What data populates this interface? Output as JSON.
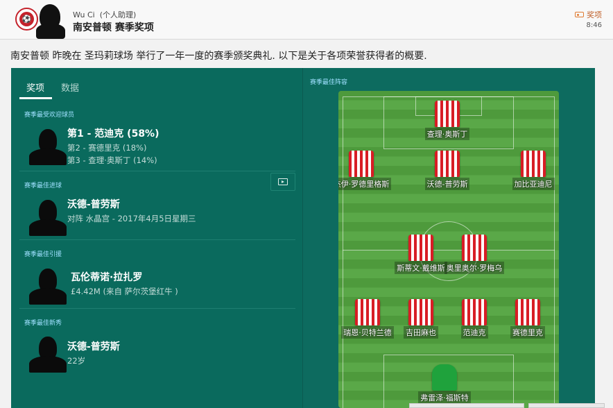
{
  "header": {
    "sender_name": "Wu Ci",
    "sender_role": "(个人助理)",
    "title": "南安普顿 赛季奖项",
    "tag_label": "奖项",
    "time": "8:46"
  },
  "intro": "南安普顿 昨晚在 圣玛莉球场 举行了一年一度的赛季颁奖典礼. 以下是关于各项荣誉获得者的概要.",
  "tabs": [
    {
      "label": "奖项",
      "active": true
    },
    {
      "label": "数据",
      "active": false
    }
  ],
  "awards": [
    {
      "title": "赛季最受欢迎球员",
      "winner": "第1 - 范迪克 (58%)",
      "line2": "第2 - 赛德里克 (18%)",
      "line3": "第3 - 查理·奥斯丁 (14%)"
    },
    {
      "title": "赛季最佳进球",
      "winner": "沃德-普劳斯",
      "line2": "对阵 水晶宫 - 2017年4月5日星期三"
    },
    {
      "title": "赛季最佳引援",
      "winner": "瓦伦蒂诺·拉扎罗",
      "line2": "£4.42M (来自 萨尔茨堡红牛 )"
    },
    {
      "title": "赛季最佳新秀",
      "winner": "沃德-普劳斯",
      "line2": "22岁"
    }
  ],
  "team_of_season": {
    "title": "赛季最佳阵容",
    "players": {
      "st": "查理·奥斯丁",
      "lw": "杰伊·罗德里格斯",
      "am": "沃德-普劳斯",
      "rw": "加比亚迪尼",
      "cm1": "斯蒂文·戴维斯",
      "cm2": "奥里奥尔·罗梅乌",
      "lb": "瑞恩·贝特兰德",
      "cb1": "吉田麻也",
      "cb2": "范迪克",
      "rb": "赛德里克",
      "gk": "弗雷泽·福斯特"
    }
  },
  "colors": {
    "panel": "#0d6b5f",
    "accent_title": "#9fe0ff",
    "shirt_red": "#d81d25",
    "gk_green": "#1fa23c"
  }
}
